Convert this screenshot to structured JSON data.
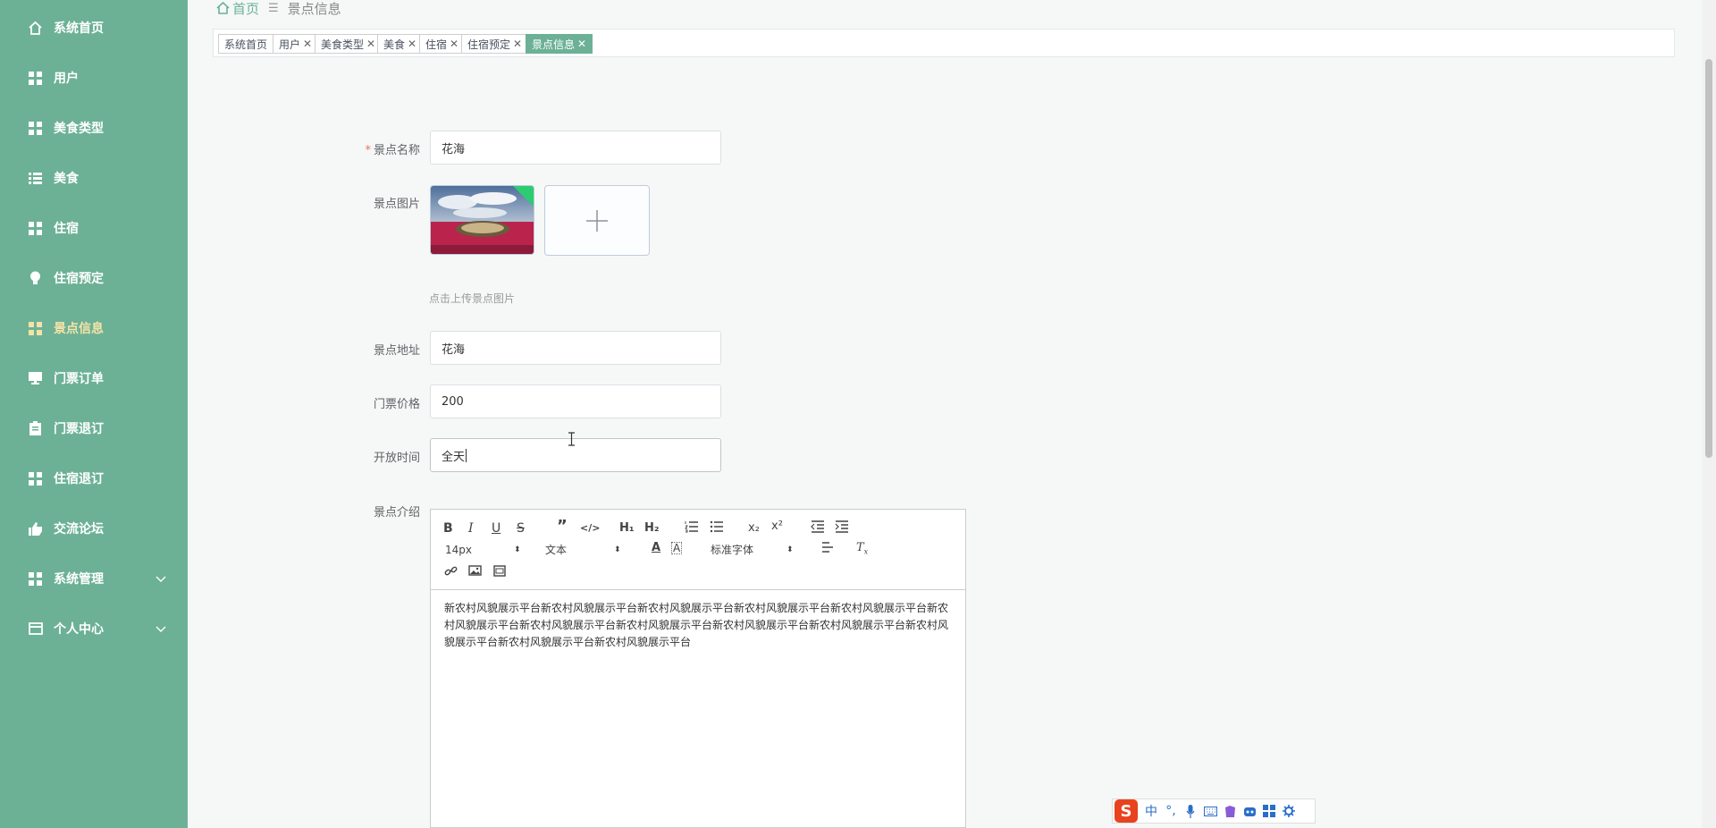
{
  "sidebar": {
    "items": [
      {
        "label": "系统首页",
        "icon": "home-icon"
      },
      {
        "label": "用户",
        "icon": "grid-icon"
      },
      {
        "label": "美食类型",
        "icon": "grid-icon"
      },
      {
        "label": "美食",
        "icon": "list-icon"
      },
      {
        "label": "住宿",
        "icon": "grid-icon"
      },
      {
        "label": "住宿预定",
        "icon": "bulb-icon"
      },
      {
        "label": "景点信息",
        "icon": "grid-icon",
        "active": true
      },
      {
        "label": "门票订单",
        "icon": "monitor-icon"
      },
      {
        "label": "门票退订",
        "icon": "clipboard-icon"
      },
      {
        "label": "住宿退订",
        "icon": "grid-icon"
      },
      {
        "label": "交流论坛",
        "icon": "thumbs-up-icon"
      },
      {
        "label": "系统管理",
        "icon": "grid-icon",
        "expandable": true
      },
      {
        "label": "个人中心",
        "icon": "card-icon",
        "expandable": true
      }
    ]
  },
  "breadcrumb": {
    "home": "首页",
    "current": "景点信息"
  },
  "tags": [
    {
      "label": "系统首页",
      "closable": false
    },
    {
      "label": "用户",
      "closable": true
    },
    {
      "label": "美食类型",
      "closable": true
    },
    {
      "label": "美食",
      "closable": true
    },
    {
      "label": "住宿",
      "closable": true
    },
    {
      "label": "住宿预定",
      "closable": true
    },
    {
      "label": "景点信息",
      "closable": true,
      "active": true
    }
  ],
  "form": {
    "name": {
      "label": "景点名称",
      "value": "花海",
      "required": true
    },
    "image": {
      "label": "景点图片",
      "hint": "点击上传景点图片"
    },
    "address": {
      "label": "景点地址",
      "value": "花海"
    },
    "price": {
      "label": "门票价格",
      "value": "200"
    },
    "hours": {
      "label": "开放时间",
      "value": "全天"
    },
    "intro": {
      "label": "景点介绍"
    }
  },
  "editor": {
    "font_size": "14px",
    "header_select": "文本",
    "font_family": "标准字体",
    "content": "新农村风貌展示平台新农村风貌展示平台新农村风貌展示平台新农村风貌展示平台新农村风貌展示平台新农村风貌展示平台新农村风貌展示平台新农村风貌展示平台新农村风貌展示平台新农村风貌展示平台新农村风貌展示平台新农村风貌展示平台新农村风貌展示平台"
  },
  "ime": {
    "mode": "中",
    "punct": "°,"
  },
  "colors": {
    "sidebar": "#6cb196",
    "active_text": "#f4e3a6",
    "required": "#f56c6c"
  }
}
